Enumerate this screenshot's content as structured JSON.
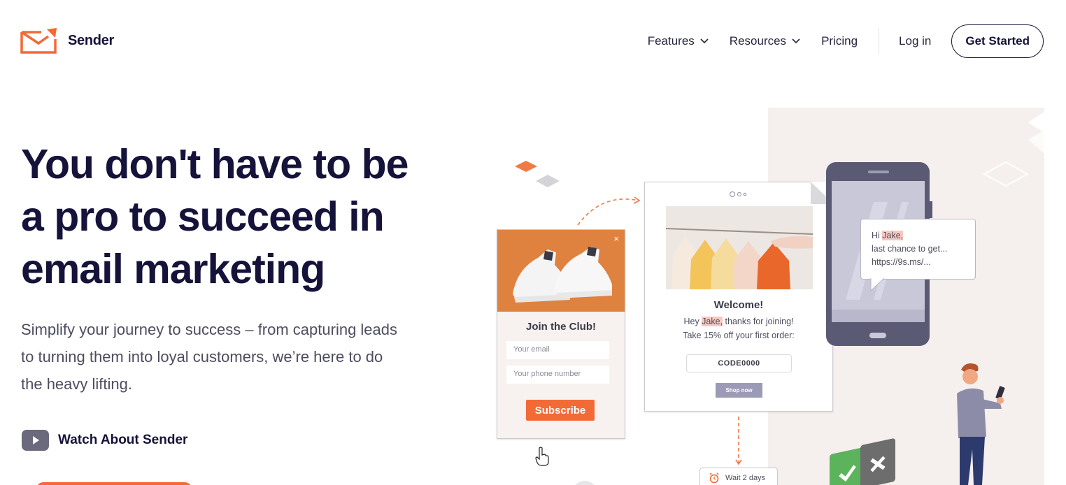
{
  "brand": {
    "name": "Sender",
    "accent": "#f26a36",
    "navy": "#15133a"
  },
  "nav": {
    "items": [
      {
        "label": "Features",
        "has_dropdown": true
      },
      {
        "label": "Resources",
        "has_dropdown": true
      },
      {
        "label": "Pricing",
        "has_dropdown": false
      }
    ],
    "login": "Log in",
    "cta": "Get Started"
  },
  "hero": {
    "title_lines": [
      "You don't have to be",
      "a pro to succeed in",
      "email marketing"
    ],
    "subtitle_lines": [
      "Simplify your journey to success – from capturing leads",
      "to turning them into loyal customers, we’re here to do",
      "the heavy lifting."
    ],
    "watch_label": "Watch About Sender"
  },
  "popup": {
    "close": "×",
    "title": "Join the Club!",
    "email_placeholder": "Your email",
    "phone_placeholder": "Your phone number",
    "button": "Subscribe"
  },
  "email": {
    "title": "Welcome!",
    "greeting_pre": "Hey ",
    "greeting_name": "Jake,",
    "greeting_post": " thanks for joining!",
    "offer": "Take 15% off your first order:",
    "code": "CODE0000",
    "button": "Shop now"
  },
  "sms": {
    "hi": "Hi ",
    "name": "Jake,",
    "line2": "last chance to get...",
    "line3": "https://9s.ms/..."
  },
  "wait": {
    "label": "Wait 2 days"
  }
}
